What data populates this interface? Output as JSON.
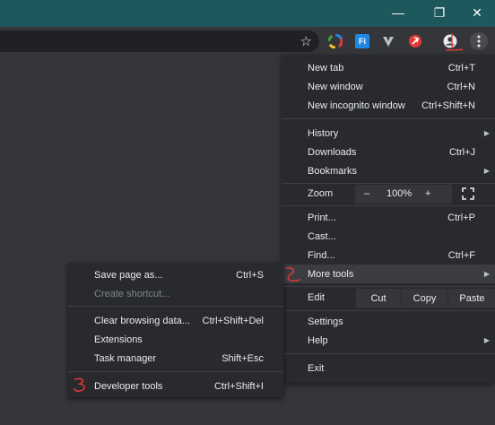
{
  "window": {
    "minimize_glyph": "—",
    "restore_glyph": "❐",
    "close_glyph": "✕"
  },
  "toolbar": {
    "star_icon": "star-icon",
    "extensions": [
      "color-wheel-icon",
      "fi-extension-icon",
      "vee-extension-icon",
      "red-extension-icon"
    ],
    "fi_label": "Fi",
    "profile_icon": "profile-icon",
    "menu_icon": "kebab-menu-icon"
  },
  "menu": {
    "new_tab": {
      "label": "New tab",
      "accel": "Ctrl+T"
    },
    "new_window": {
      "label": "New window",
      "accel": "Ctrl+N"
    },
    "new_incognito": {
      "label": "New incognito window",
      "accel": "Ctrl+Shift+N"
    },
    "history": {
      "label": "History"
    },
    "downloads": {
      "label": "Downloads",
      "accel": "Ctrl+J"
    },
    "bookmarks": {
      "label": "Bookmarks"
    },
    "zoom": {
      "label": "Zoom",
      "minus": "–",
      "value": "100%",
      "plus": "+"
    },
    "print": {
      "label": "Print...",
      "accel": "Ctrl+P"
    },
    "cast": {
      "label": "Cast..."
    },
    "find": {
      "label": "Find...",
      "accel": "Ctrl+F"
    },
    "more_tools": {
      "label": "More tools"
    },
    "edit": {
      "label": "Edit",
      "cut": "Cut",
      "copy": "Copy",
      "paste": "Paste"
    },
    "settings": {
      "label": "Settings"
    },
    "help": {
      "label": "Help"
    },
    "exit": {
      "label": "Exit"
    }
  },
  "submenu": {
    "save_page": {
      "label": "Save page as...",
      "accel": "Ctrl+S"
    },
    "create_shortcut": {
      "label": "Create shortcut..."
    },
    "clear_browsing": {
      "label": "Clear browsing data...",
      "accel": "Ctrl+Shift+Del"
    },
    "extensions": {
      "label": "Extensions"
    },
    "task_manager": {
      "label": "Task manager",
      "accel": "Shift+Esc"
    },
    "developer_tools": {
      "label": "Developer tools",
      "accel": "Ctrl+Shift+I"
    }
  },
  "annotations": {
    "color": "#e53935"
  }
}
